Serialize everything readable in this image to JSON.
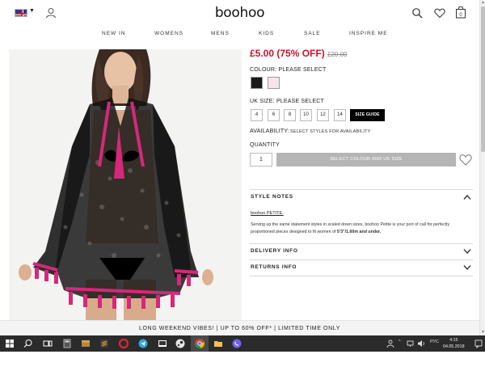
{
  "header": {
    "logo": "boohoo",
    "flag_icon": "uk-flag-icon",
    "icons": [
      "user-icon",
      "search-icon",
      "heart-icon",
      "bag-icon"
    ],
    "bag_count": "0"
  },
  "nav": {
    "items": [
      "NEW IN",
      "WOMENS",
      "MENS",
      "KIDS",
      "SALE",
      "INSPIRE ME"
    ]
  },
  "product": {
    "price": "£5.00 (75% OFF)",
    "was_price": "£20.00",
    "colour_label": "COLOUR:",
    "colour_value": "PLEASE SELECT",
    "swatch_colors": [
      "#1a1a1a",
      "#f7e4ea"
    ],
    "size_label": "UK SIZE:",
    "size_value": "PLEASE SELECT",
    "sizes": [
      "4",
      "6",
      "8",
      "10",
      "12",
      "14"
    ],
    "size_guide": "SIZE GUIDE",
    "availability_label": "AVAILABILITY:",
    "availability_text": "SELECT STYLES FOR AVAILABILITY",
    "quantity_label": "QUANTITY",
    "quantity_value": "1",
    "add_button": "SELECT COLOUR AND UK SIZE"
  },
  "accordion": {
    "style_notes_title": "STYLE NOTES",
    "petite_link": "boohoo PETITE.",
    "notes_text": "Serving up the same statement styles in scaled down sizes, boohoo Petite is your port of call for perfectly proportioned pieces designed to fit women of ",
    "notes_bold": "5'3\"/1.60m and under.",
    "delivery_title": "DELIVERY INFO",
    "returns_title": "RETURNS INFO"
  },
  "promo": {
    "text": "LONG WEEKEND VIBES! | UP TO 60% OFF* | LIMITED TIME ONLY"
  },
  "taskbar": {
    "language": "РУС",
    "time": "4:15",
    "date": "04.05.2018",
    "apps": [
      "windows-start-icon",
      "search-icon",
      "task-view-icon",
      "calculator-icon",
      "archive-icon",
      "sublime-text-icon",
      "opera-icon",
      "telegram-icon",
      "desktop-app-icon",
      "steam-icon",
      "chrome-icon",
      "folder-icon",
      "viber-icon"
    ]
  },
  "colors": {
    "sale_red": "#d4102b",
    "size_guide_bg": "#000000",
    "disabled_button": "#b5b5b5",
    "taskbar": "#2b2b2b"
  }
}
